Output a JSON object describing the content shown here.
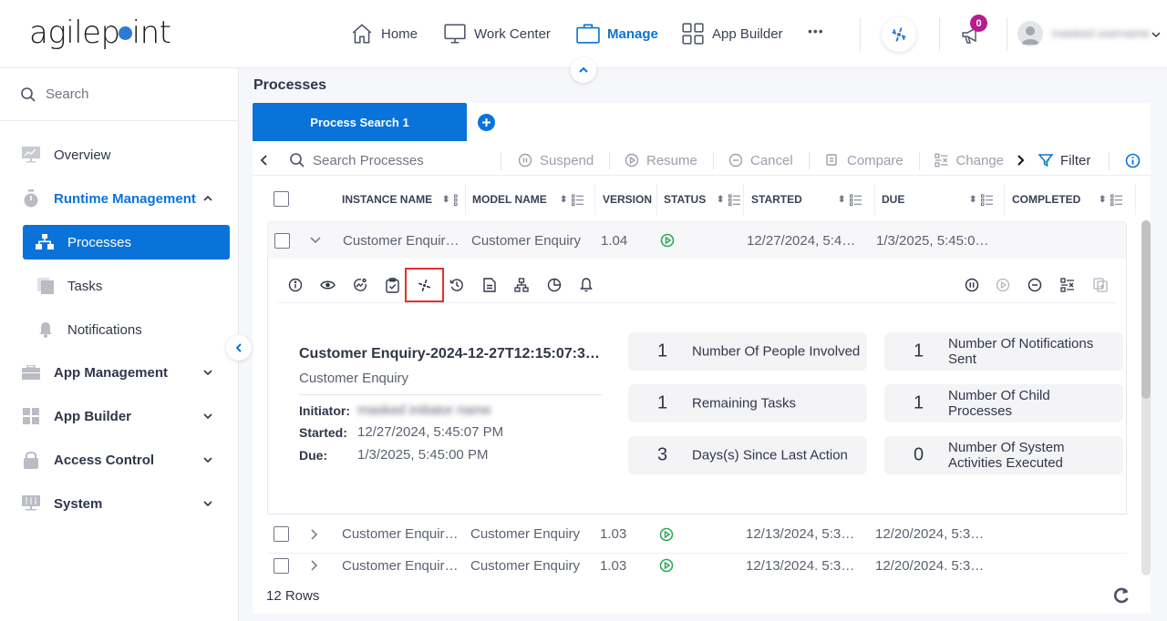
{
  "header": {
    "logo_text_pre": "agilep",
    "logo_text_post": "int",
    "nav": [
      {
        "label": "Home",
        "icon": "home-icon",
        "active": false
      },
      {
        "label": "Work Center",
        "icon": "monitor-icon",
        "active": false
      },
      {
        "label": "Manage",
        "icon": "briefcase-icon",
        "active": true
      },
      {
        "label": "App Builder",
        "icon": "grid-icon",
        "active": false
      }
    ],
    "more_label": "•••",
    "notifications_count": "0",
    "user_name": "masked username",
    "accent_color": "#0a73d9",
    "badge_color": "#b81b8c"
  },
  "sidebar": {
    "search_placeholder": "Search",
    "items": [
      {
        "label": "Overview",
        "icon": "overview-icon"
      },
      {
        "label": "Runtime Management",
        "icon": "stopwatch-icon",
        "expanded": true
      },
      {
        "label": "Processes",
        "icon": "process-tree-icon",
        "selected": true
      },
      {
        "label": "Tasks",
        "icon": "tasks-icon"
      },
      {
        "label": "Notifications",
        "icon": "bell-icon"
      },
      {
        "label": "App Management",
        "icon": "toolbox-icon"
      },
      {
        "label": "App Builder",
        "icon": "app-builder-icon"
      },
      {
        "label": "Access Control",
        "icon": "lock-icon"
      },
      {
        "label": "System",
        "icon": "system-icon"
      }
    ]
  },
  "main": {
    "title": "Processes",
    "tabs": [
      {
        "label": "Process Search 1",
        "active": true
      }
    ],
    "toolbar": {
      "search_placeholder": "Search Processes",
      "suspend": "Suspend",
      "resume": "Resume",
      "cancel": "Cancel",
      "compare": "Compare",
      "change": "Change",
      "filter": "Filter"
    },
    "columns": [
      "INSTANCE NAME",
      "MODEL NAME",
      "VERSION",
      "STATUS",
      "STARTED",
      "DUE",
      "COMPLETED"
    ],
    "rows": [
      {
        "instance": "Customer Enquir…",
        "model": "Customer Enquiry",
        "version": "1.04",
        "status": "running",
        "started": "12/27/2024, 5:4…",
        "due": "1/3/2025, 5:45:0…",
        "completed": "",
        "expanded": true
      },
      {
        "instance": "Customer Enquir…",
        "model": "Customer Enquiry",
        "version": "1.03",
        "status": "running",
        "started": "12/13/2024, 5:3…",
        "due": "12/20/2024, 5:3…",
        "completed": "",
        "expanded": false
      },
      {
        "instance": "Customer Enquir…",
        "model": "Customer Enquiry",
        "version": "1.03",
        "status": "running",
        "started": "12/13/2024. 5:3…",
        "due": "12/20/2024. 5:3…",
        "completed": "",
        "expanded": false
      }
    ],
    "detail": {
      "title": "Customer Enquiry-2024-12-27T12:15:07:3…",
      "subtitle": "Customer Enquiry",
      "initiator_label": "Initiator:",
      "initiator_value": "masked initiator name",
      "started_label": "Started:",
      "started_value": "12/27/2024, 5:45:07 PM",
      "due_label": "Due:",
      "due_value": "1/3/2025, 5:45:00 PM",
      "actions_left": [
        "info-icon",
        "view-icon",
        "progress-icon",
        "task-check-icon",
        "process-spinner-icon",
        "history-icon",
        "document-icon",
        "hierarchy-icon",
        "pie-icon",
        "bell-icon"
      ],
      "highlighted_action": "process-spinner-icon",
      "actions_right": [
        "suspend-icon",
        "resume-icon",
        "cancel-icon",
        "change-icon",
        "compare-icon"
      ],
      "stats": [
        {
          "value": "1",
          "label": "Number Of People Involved"
        },
        {
          "value": "1",
          "label": "Number Of Notifications Sent"
        },
        {
          "value": "1",
          "label": "Remaining Tasks"
        },
        {
          "value": "1",
          "label": "Number Of Child Processes"
        },
        {
          "value": "3",
          "label": "Days(s) Since Last Action"
        },
        {
          "value": "0",
          "label": "Number Of System Activities Executed"
        }
      ]
    },
    "row_count": "12 Rows"
  }
}
